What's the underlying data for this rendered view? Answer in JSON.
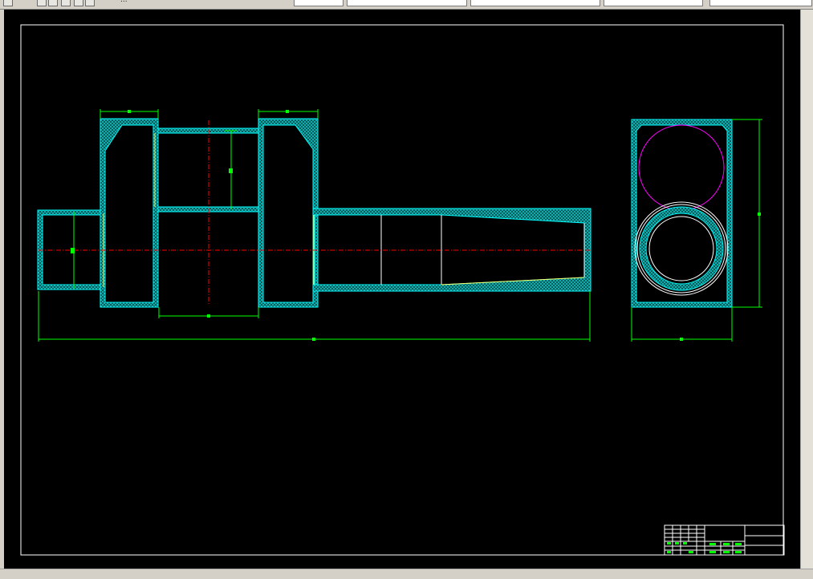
{
  "app": {
    "toolbar_text": "..."
  },
  "colors": {
    "background": "#000000",
    "frame": "#ffffff",
    "section_outline": "#00ffff",
    "hatch": "#00cccc",
    "dimension": "#00ff00",
    "centerline": "#ff0000",
    "circle_magenta": "#ff00ff",
    "thin_line": "#ffffff",
    "yellow_line": "#ffff66"
  },
  "icons": [
    "toolbar-open-icon",
    "toolbar-tool-icon"
  ]
}
